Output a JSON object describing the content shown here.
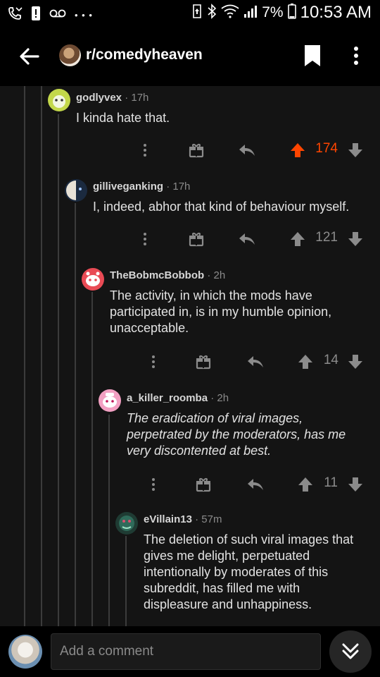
{
  "status_bar": {
    "battery_percent": "7%",
    "time": "10:53 AM",
    "notification_dots": "• • •"
  },
  "app_bar": {
    "subreddit": "r/comedyheaven"
  },
  "colors": {
    "upvote_active": "#ff4500",
    "background": "#141414",
    "text": "#e2e2e2",
    "meta": "#8b8b8b"
  },
  "comments": [
    {
      "username": "godlyvex",
      "age": "· 17h",
      "body": "I kinda hate that.",
      "score": "174",
      "upvoted": true,
      "avatar_color": "#c3d84a"
    },
    {
      "username": "gilliveganking",
      "age": "· 17h",
      "body": "I, indeed, abhor that kind of behaviour myself.",
      "score": "121",
      "upvoted": false,
      "avatar_color": "#1b2a3f"
    },
    {
      "username": "TheBobmcBobbob",
      "age": "· 2h",
      "body": "The activity, in which the mods have participated in, is in my humble opinion, unacceptable.",
      "score": "14",
      "upvoted": false,
      "avatar_color": "#e94b55"
    },
    {
      "username": "a_killer_roomba",
      "age": "· 2h",
      "body": "The eradication of viral images, perpetrated by the moderators, has me very discontented at best.",
      "score": "11",
      "upvoted": false,
      "avatar_color": "#f2a0c2"
    },
    {
      "username": "eVillain13",
      "age": "· 57m",
      "body": "The deletion of such viral images that gives me delight, perpetuated intentionally by moderates of this subreddit, has filled me with displeasure and unhappiness.",
      "upvoted": false,
      "avatar_color": "#2f6b5a"
    }
  ],
  "bottom_bar": {
    "comment_placeholder": "Add a comment"
  }
}
